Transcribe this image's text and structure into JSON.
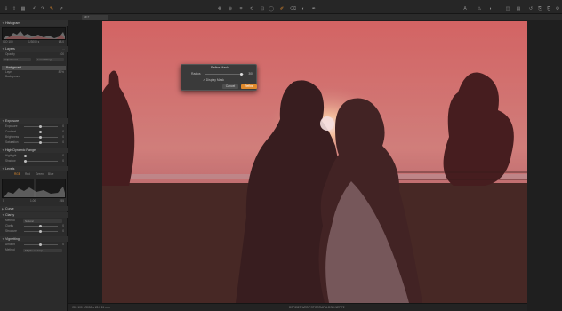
{
  "app": {
    "title": "Capture One"
  },
  "toolbar": {
    "left_icons": [
      "import-icon",
      "export-icon",
      "grid-icon",
      "undo-icon",
      "redo-icon",
      "brush-icon",
      "cursor-icon",
      "crop-icon"
    ],
    "center_icons": [
      "pan-icon",
      "zoom-icon",
      "crop-tool-icon",
      "rotate-icon",
      "keystone-icon",
      "spot-icon",
      "brush-tool-icon",
      "eraser-icon",
      "gradient-icon",
      "picker-icon",
      "wb-picker-icon"
    ],
    "right_icons": [
      "text-icon",
      "warning-icon",
      "exposure-icon",
      "compare-icon",
      "grid-view-icon",
      "reset-icon",
      "copy-icon",
      "paste-icon",
      "settings-icon",
      "help-icon"
    ]
  },
  "subbar": {
    "selector": "MKT"
  },
  "left_panel": {
    "histogram": {
      "title": "Histogram",
      "left_info": "ISO 100",
      "mid_info": "1/3000 s",
      "right_info": "f/8.0"
    },
    "layers": {
      "title": "Layers",
      "opacity_label": "Opacity",
      "opacity_value": "100",
      "adjustment_label": "Adjustment",
      "luma_label": "Luma Range",
      "items": [
        {
          "name": "Background",
          "value": ""
        },
        {
          "name": "Layer",
          "value": "80%"
        },
        {
          "name": "Background",
          "value": ""
        }
      ]
    },
    "exposure": {
      "title": "Exposure",
      "rows": [
        {
          "label": "Exposure",
          "value": "0"
        },
        {
          "label": "Contrast",
          "value": "0"
        },
        {
          "label": "Brightness",
          "value": "0"
        },
        {
          "label": "Saturation",
          "value": "0"
        }
      ]
    },
    "hdr": {
      "title": "High Dynamic Range",
      "rows": [
        {
          "label": "Highlight",
          "value": "0"
        },
        {
          "label": "Shadow",
          "value": "0"
        }
      ]
    },
    "levels": {
      "title": "Levels",
      "tabs": [
        "RGB",
        "Red",
        "Green",
        "Blue"
      ],
      "min_val": "0",
      "mid_val": "1.00",
      "max_val": "255"
    },
    "curve": {
      "title": "Curve"
    },
    "clarity": {
      "title": "Clarity",
      "method_label": "Method",
      "method_value": "Natural",
      "rows": [
        {
          "label": "Clarity",
          "value": "0"
        },
        {
          "label": "Structure",
          "value": "0"
        }
      ]
    },
    "vignetting": {
      "title": "Vignetting",
      "rows": [
        {
          "label": "Amount",
          "value": "0"
        }
      ],
      "method_label": "Method",
      "method_value": "Elliptic on Crop"
    }
  },
  "dialog": {
    "title": "Refine Mask",
    "radius_label": "Radius",
    "radius_value": "300",
    "checkbox_label": "Display Mask",
    "checkbox_checked": true,
    "cancel_label": "Cancel",
    "ok_label": "Refine"
  },
  "statusbar": {
    "left": "ISO 100    1/3000 s    f/8.0    24 mm",
    "center": "DSF6523 WEB FOTOGRAFIA.DSH.NEF 72"
  },
  "colors": {
    "accent": "#e08a2c",
    "mask_overlay": "#c24a4a",
    "panel_bg": "#2b2b2b"
  }
}
